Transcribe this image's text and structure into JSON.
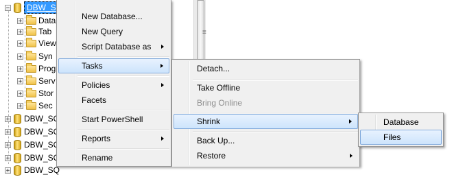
{
  "tree": {
    "selected_db": "DBW_SQL_ENG",
    "folders": [
      "Datab",
      "Tab",
      "View",
      "Syn",
      "Prog",
      "Serv",
      "Stor",
      "Sec"
    ],
    "other_dbs": [
      "DBW_SQ",
      "DBW_SQ",
      "DBW_SQ",
      "DBW_SQ",
      "DBW_SQ"
    ]
  },
  "context_menu": {
    "items": [
      "New Database...",
      "New Query",
      "Script Database as",
      "Tasks",
      "Policies",
      "Facets",
      "Start PowerShell",
      "Reports",
      "Rename"
    ]
  },
  "tasks_menu": {
    "items": [
      "Detach...",
      "Take Offline",
      "Bring Online",
      "Shrink",
      "Back Up...",
      "Restore"
    ]
  },
  "shrink_menu": {
    "items": [
      "Database",
      "Files"
    ]
  },
  "colors": {
    "selection": "#3399ff",
    "menu_highlight": "#cde4fc",
    "menu_background": "#f0f0f0"
  }
}
